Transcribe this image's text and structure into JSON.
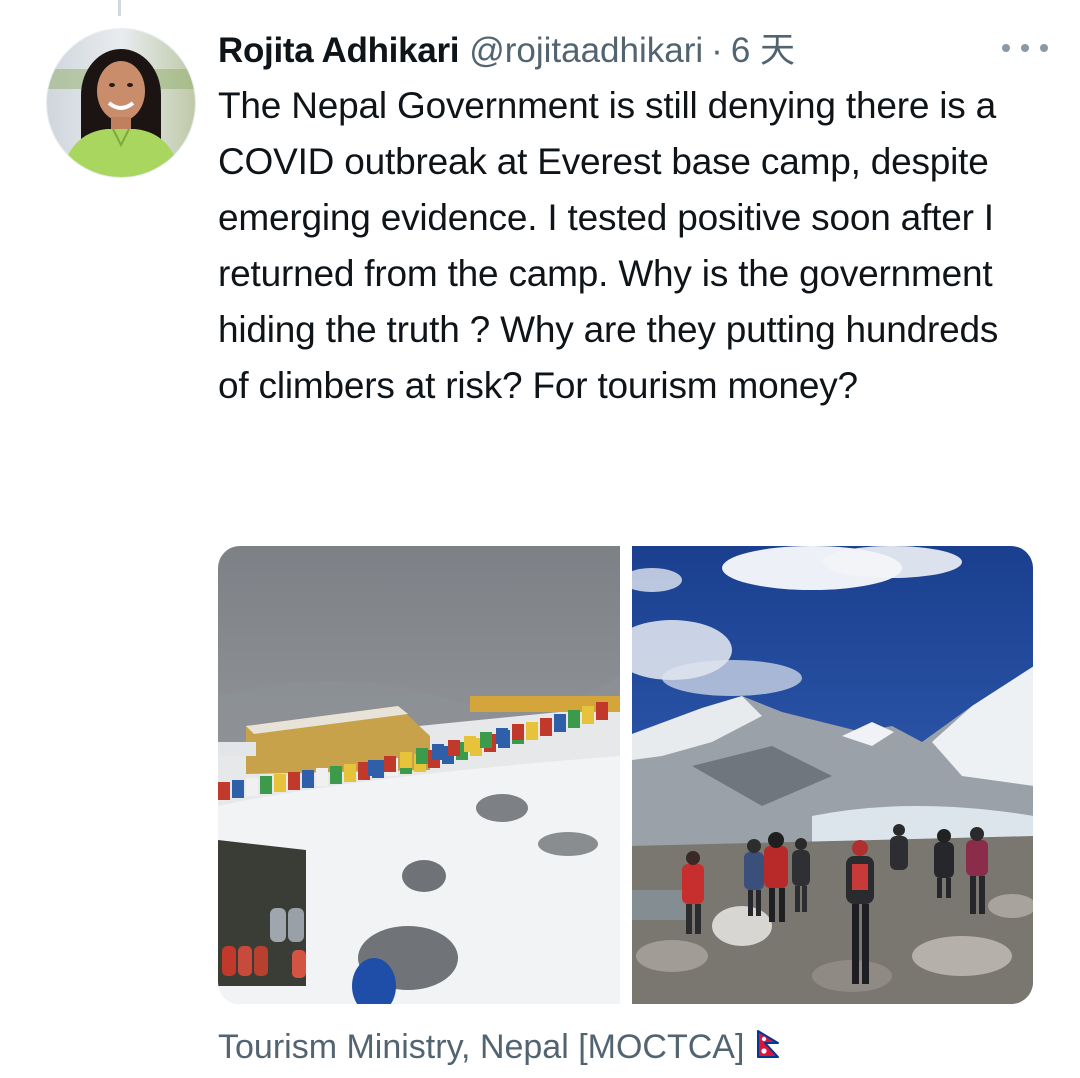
{
  "tweet": {
    "author_name": "Rojita Adhikari",
    "author_handle": "@rojitaadhikari",
    "separator": "·",
    "time": "6 天",
    "text": "The Nepal Government is still denying there is a COVID outbreak at Everest base camp, despite emerging evidence. I tested positive soon after I returned from the camp. Why is the government hiding the truth ? Why are they putting hundreds of climbers at risk? For tourism money?",
    "media_caption": "Tourism Ministry, Nepal [MOCTCA]",
    "icons": [
      "more-options-icon",
      "nepal-flag-icon"
    ]
  },
  "colors": {
    "text_primary": "#0f1419",
    "text_secondary": "#536471"
  }
}
